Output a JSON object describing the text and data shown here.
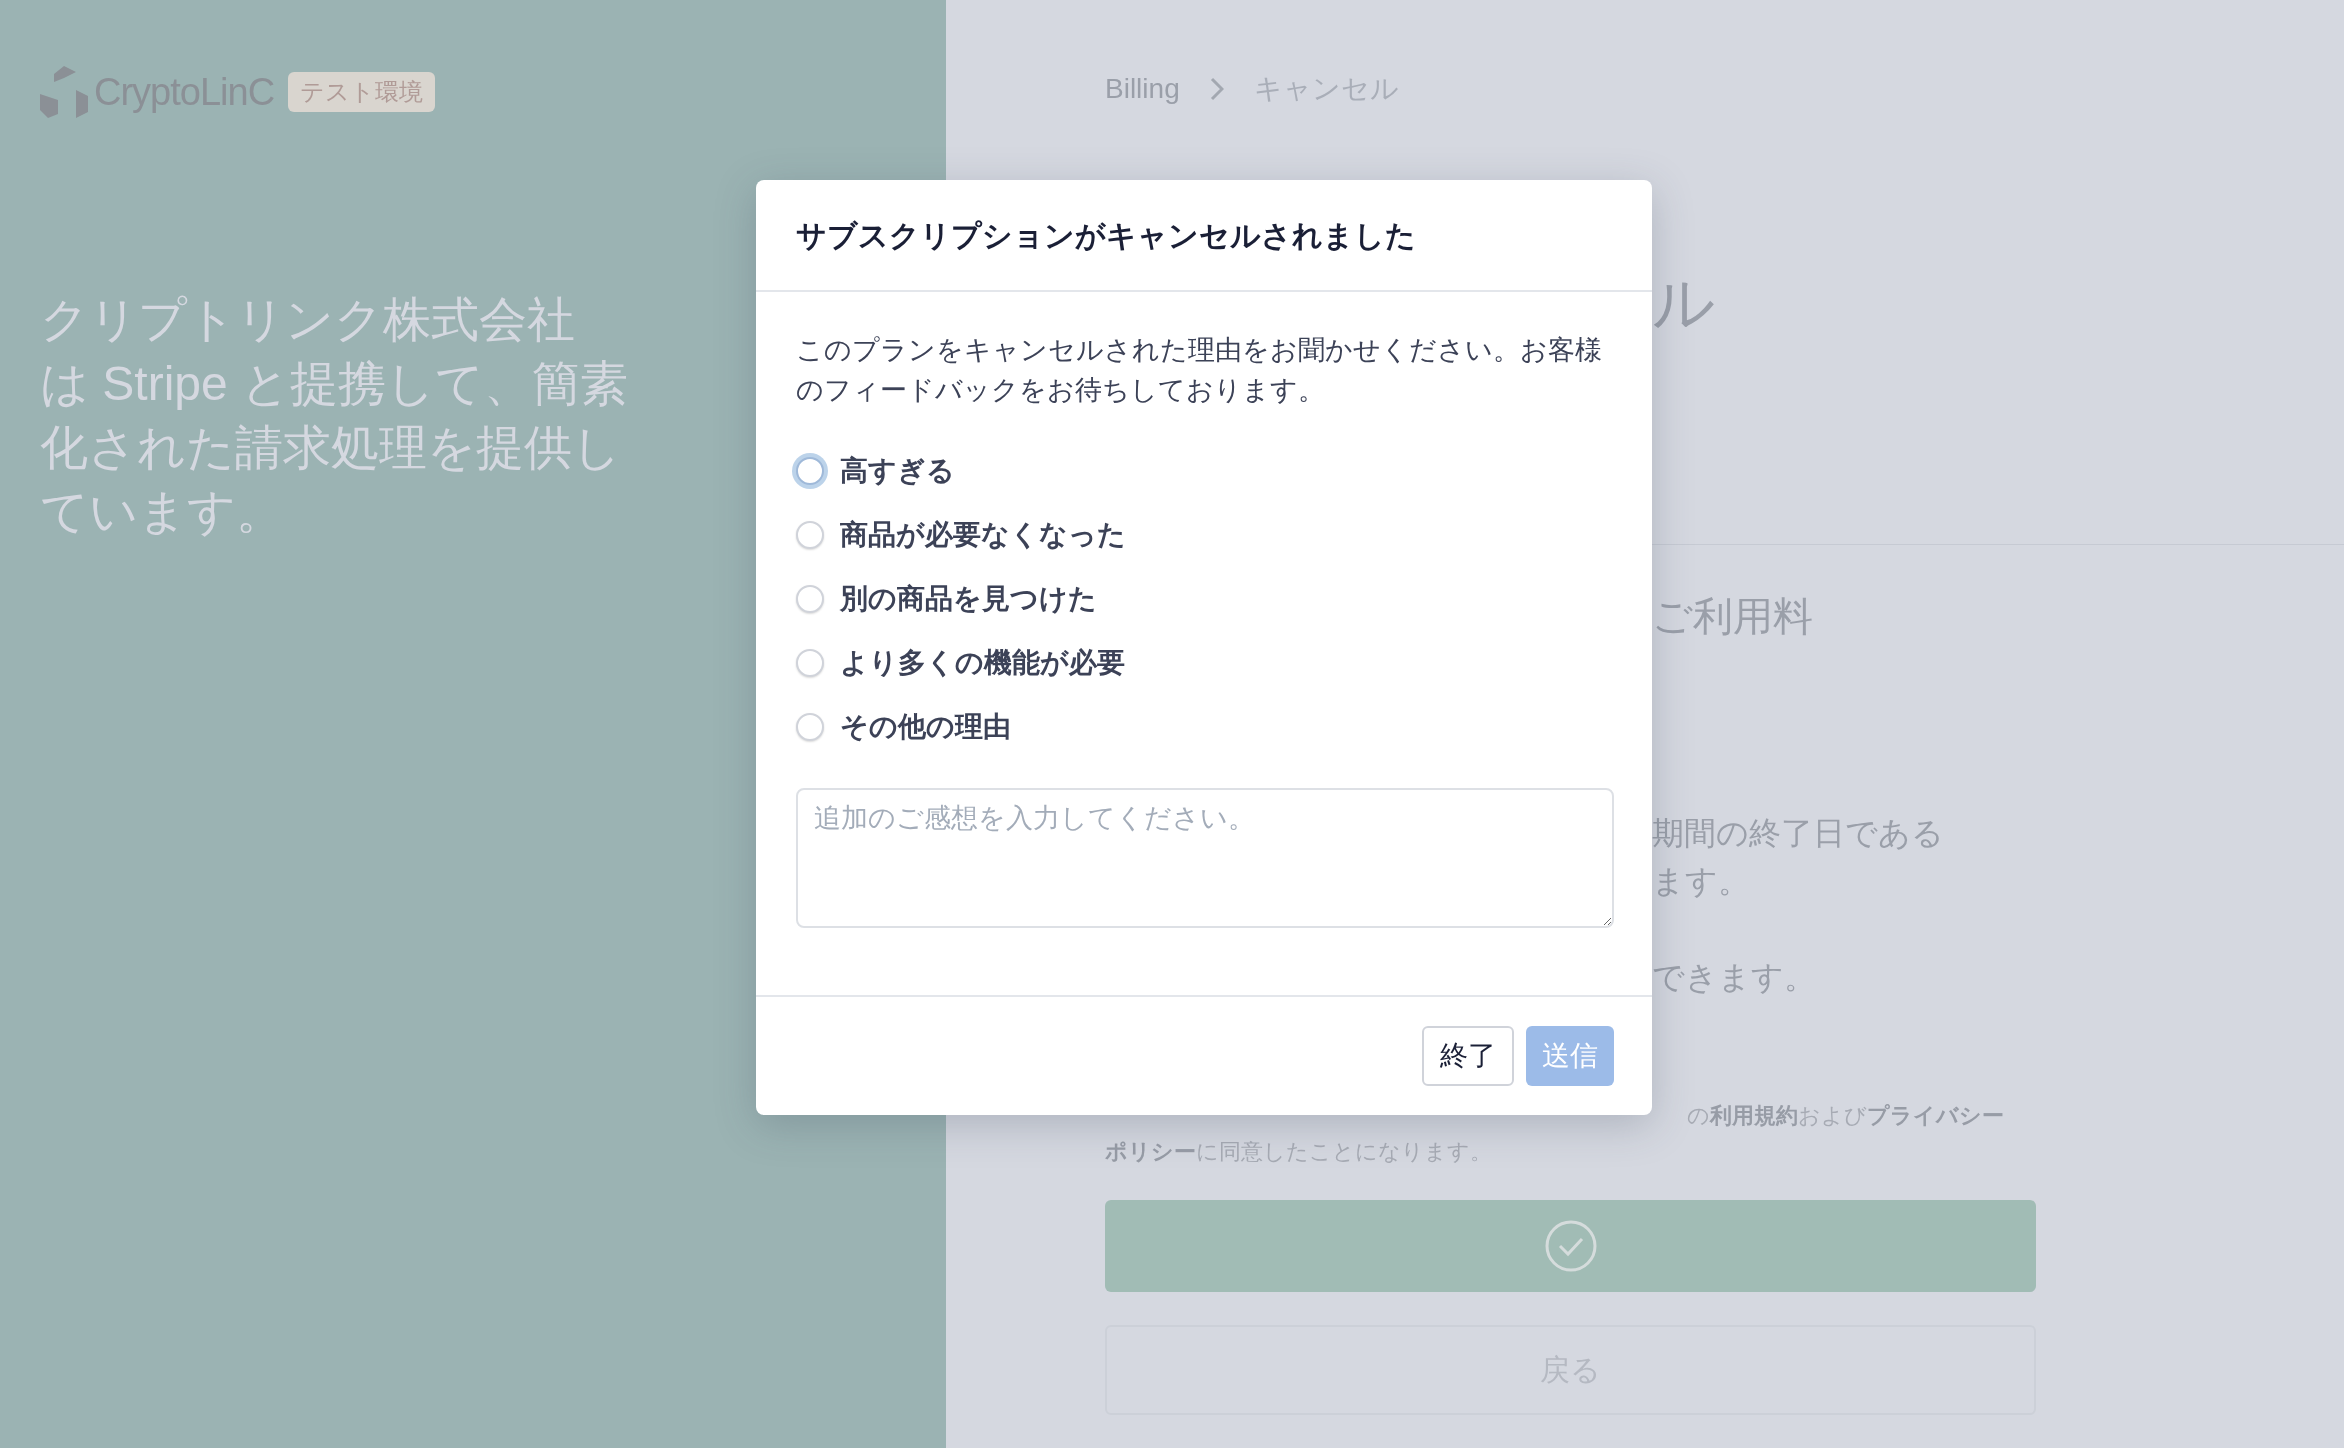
{
  "brand": {
    "name": "CryptoLinC",
    "badge": "テスト環境"
  },
  "tagline_lines": [
    "クリプトリンク株式会社",
    "は Stripe と提携して、簡素",
    "化された請求処理を提供し",
    "ています。"
  ],
  "breadcrumb": [
    "Billing",
    "キャンセル"
  ],
  "background": {
    "heading_fragment": "ル",
    "section_fragment": "ご利用料",
    "note_lines": [
      "期間の終了日である",
      "ます。",
      "できます。"
    ],
    "terms_lines": [
      "の**利用規約**および**プライバシー**",
      "**ポリシー**に同意したことになります。"
    ],
    "back_button": "戻る"
  },
  "modal": {
    "title": "サブスクリプションがキャンセルされました",
    "message": "このプランをキャンセルされた理由をお聞かせください。お客様のフィードバックをお待ちしております。",
    "reasons": [
      {
        "label": "高すぎる",
        "selected": false,
        "focused": true
      },
      {
        "label": "商品が必要なくなった",
        "selected": false,
        "focused": false
      },
      {
        "label": "別の商品を見つけた",
        "selected": false,
        "focused": false
      },
      {
        "label": "より多くの機能が必要",
        "selected": false,
        "focused": false
      },
      {
        "label": "その他の理由",
        "selected": false,
        "focused": false
      }
    ],
    "placeholder": "追加のご感想を入力してください。",
    "buttons": [
      {
        "label": "終了",
        "kind": "secondary",
        "disabled": false
      },
      {
        "label": "送信",
        "kind": "primary",
        "disabled": true
      }
    ]
  }
}
